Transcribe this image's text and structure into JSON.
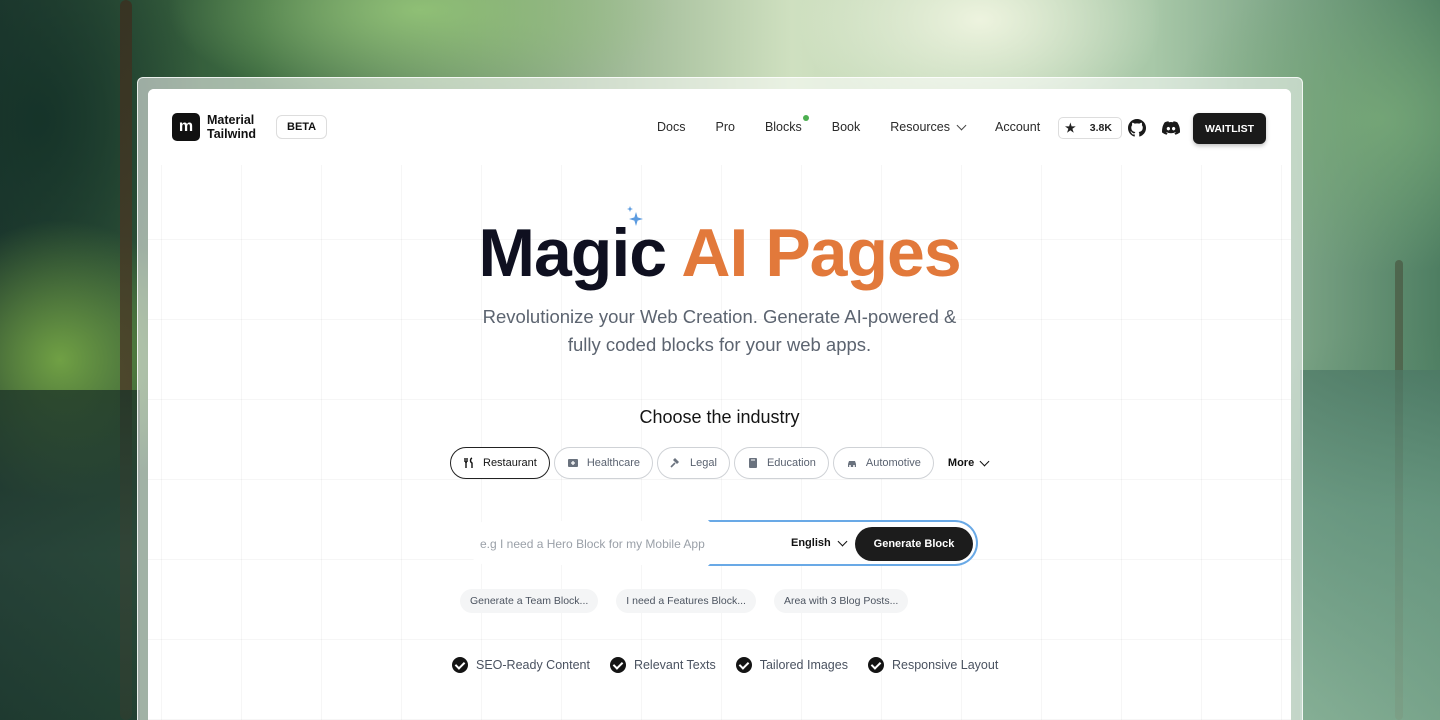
{
  "brand": {
    "logo_letter": "m",
    "name": "Material Tailwind",
    "badge": "BETA"
  },
  "nav": {
    "links": [
      {
        "label": "Docs"
      },
      {
        "label": "Pro"
      },
      {
        "label": "Blocks"
      },
      {
        "label": "Book"
      },
      {
        "label": "Resources"
      },
      {
        "label": "Account"
      }
    ],
    "github_stars": "3.8K",
    "waitlist_label": "WAITLIST"
  },
  "hero": {
    "title_part1": "Magic",
    "title_part2": "AI Pages",
    "subtitle_line1": "Revolutionize your Web Creation. Generate AI-powered &",
    "subtitle_line2": "fully coded blocks for your web apps."
  },
  "industry": {
    "heading": "Choose the industry",
    "chips": [
      {
        "label": "Restaurant",
        "icon": "utensils-icon"
      },
      {
        "label": "Healthcare",
        "icon": "medical-icon"
      },
      {
        "label": "Legal",
        "icon": "gavel-icon"
      },
      {
        "label": "Education",
        "icon": "book-icon"
      },
      {
        "label": "Automotive",
        "icon": "car-icon"
      }
    ],
    "more_label": "More"
  },
  "prompt": {
    "placeholder": "e.g I need a Hero Block for my Mobile App",
    "language": "English",
    "generate_label": "Generate Block"
  },
  "suggestions": [
    "Generate a Team Block...",
    "I need a Features Block...",
    "Area with 3 Blog Posts..."
  ],
  "features": [
    "SEO-Ready Content",
    "Relevant Texts",
    "Tailored Images",
    "Responsive Layout"
  ],
  "colors": {
    "accent": "#e2793b",
    "dark": "#1c1c1c",
    "glow": "#69a9e6",
    "new_dot": "#4caf50"
  }
}
